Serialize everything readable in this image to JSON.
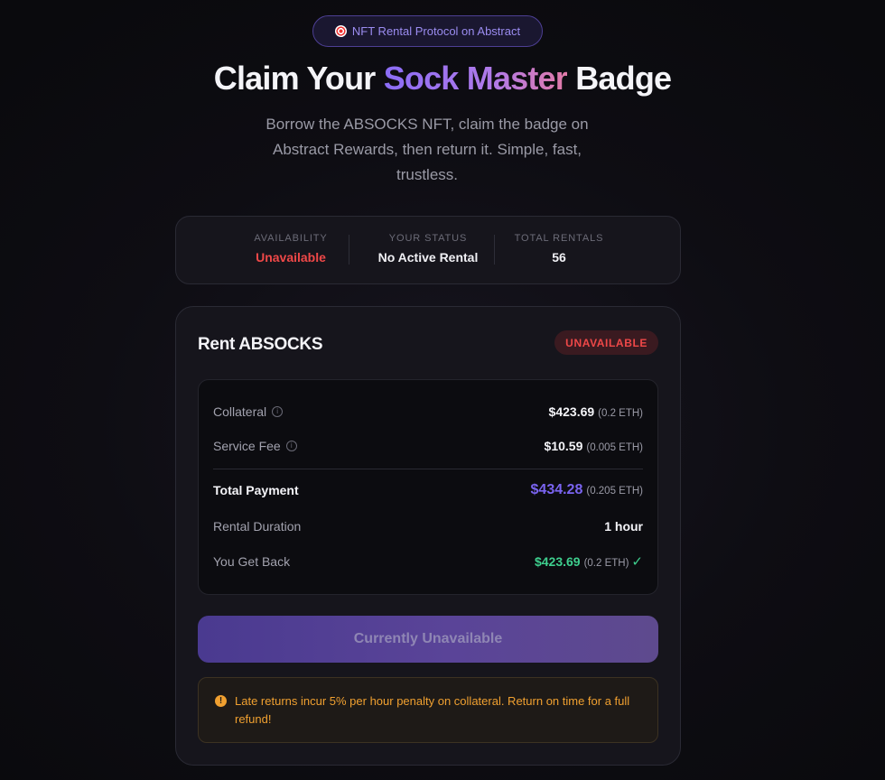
{
  "header": {
    "pill_label": "NFT Rental Protocol on Abstract",
    "title_prefix": "Claim Your",
    "title_highlight": "Sock Master",
    "title_suffix": "Badge",
    "subtitle": "Borrow the ABSOCKS NFT, claim the badge on Abstract Rewards, then return it. Simple, fast, trustless."
  },
  "stats": [
    {
      "label": "AVAILABILITY",
      "value": "Unavailable",
      "color": "#ef4848"
    },
    {
      "label": "YOUR STATUS",
      "value": "No Active Rental"
    },
    {
      "label": "TOTAL RENTALS",
      "value": "56"
    }
  ],
  "rent_card": {
    "title": "Rent ABSOCKS",
    "badge": "UNAVAILABLE",
    "rows": {
      "collateral": {
        "label": "Collateral",
        "usd": "$423.69",
        "eth": "(0.2 ETH)"
      },
      "service_fee": {
        "label": "Service Fee",
        "usd": "$10.59",
        "eth": "(0.005 ETH)"
      },
      "total_payment": {
        "label": "Total Payment",
        "usd": "$434.28",
        "eth": "(0.205 ETH)"
      },
      "rental_duration": {
        "label": "Rental Duration",
        "value": "1 hour"
      },
      "you_get_back": {
        "label": "You Get Back",
        "usd": "$423.69",
        "eth": "(0.2 ETH)",
        "check": "✓"
      }
    },
    "cta_label": "Currently Unavailable",
    "warning": "Late returns incur 5% per hour penalty on collateral. Return on time for a full refund!"
  },
  "colors": {
    "accent_purple": "#7a64f0",
    "success_green": "#3ecf8e",
    "danger_red": "#ef4848",
    "warning_orange": "#f0a030"
  }
}
